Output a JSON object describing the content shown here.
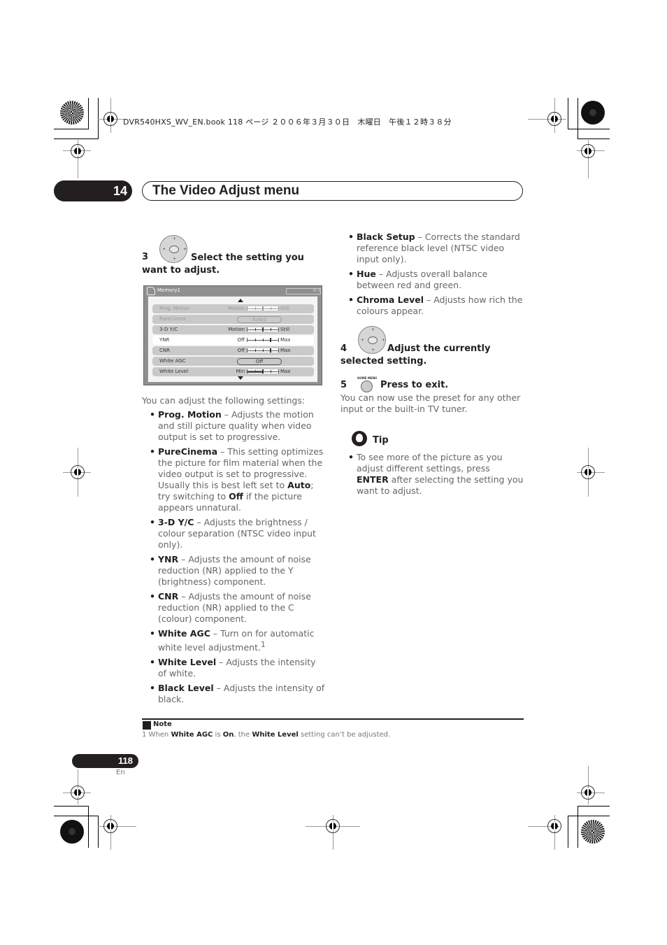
{
  "print_header": {
    "text": "DVR540HXS_WV_EN.book  118 ページ  ２００６年３月３０日　木曜日　午後１２時３８分"
  },
  "chapter": {
    "number": "14",
    "title": "The Video Adjust menu"
  },
  "steps": [
    {
      "number": "3",
      "icon": "dpad-enter-icon",
      "text": "Select the setting you want to adjust."
    },
    {
      "number": "4",
      "icon": "dpad-enter-icon",
      "text": "Adjust the currently selected setting."
    },
    {
      "number": "5",
      "icon": "home-menu-button-icon",
      "icon_label": "HOME MENU",
      "text": "Press to exit."
    }
  ],
  "osd": {
    "title": "Memory1",
    "corner_label": "Pr 1",
    "rows": [
      {
        "label": "Prog.  Motion",
        "low": "Motion",
        "high": "Still",
        "type": "slider",
        "level": 0.5,
        "state": "disabled"
      },
      {
        "label": "PureCinma",
        "type": "pill",
        "value": "Auto1",
        "state": "disabled"
      },
      {
        "label": "3-D  Y/C",
        "low": "Motion",
        "high": "Still",
        "type": "slider",
        "level": 0.5,
        "state": "normal"
      },
      {
        "label": "YNR",
        "low": "Off",
        "high": "Max",
        "type": "slider",
        "level": 0.75,
        "state": "selected"
      },
      {
        "label": "CNR",
        "low": "Off",
        "high": "Max",
        "type": "slider",
        "level": 0.75,
        "state": "normal"
      },
      {
        "label": "White  AGC",
        "type": "pill",
        "value": "Off",
        "state": "normal"
      },
      {
        "label": "White  Level",
        "low": "Min",
        "high": "Max",
        "type": "slider",
        "level": 0.5,
        "state": "normal"
      }
    ]
  },
  "intro": "You can adjust the following settings:",
  "settings_left": [
    {
      "term": "Prog. Motion",
      "desc": " – Adjusts the motion and still picture quality when video output is set to progressive."
    },
    {
      "term": "PureCinema",
      "desc": " –  This setting optimizes the picture for film material when the video output is set to progressive. Usually this is best left set to ",
      "b1": "Auto",
      "mid": "; try switching to ",
      "b2": "Off",
      "end": " if the picture appears unnatural."
    },
    {
      "term": "3-D Y/C",
      "desc": " – Adjusts the brightness / colour separation (NTSC video input only)."
    },
    {
      "term": "YNR",
      "desc": " – Adjusts the amount of noise reduction (NR) applied to the Y (brightness) component."
    },
    {
      "term": "CNR",
      "desc": " – Adjusts the amount of noise reduction (NR) applied to the C (colour) component."
    },
    {
      "term": "White AGC",
      "desc": " – Turn on for automatic white level adjustment.",
      "sup": "1"
    },
    {
      "term": "White Level",
      "desc": " – Adjusts the intensity of white."
    },
    {
      "term": "Black Level",
      "desc": " – Adjusts the intensity of black."
    }
  ],
  "settings_right": [
    {
      "term": "Black Setup",
      "desc": " – Corrects the standard reference black level (NTSC video input only)."
    },
    {
      "term": "Hue",
      "desc": " – Adjusts overall balance between red and green."
    },
    {
      "term": "Chroma Level",
      "desc": " – Adjusts how rich the colours appear."
    }
  ],
  "step5_body": "You can now use the preset for any other input or the built-in TV tuner.",
  "tip": {
    "label": "Tip",
    "pre": "To see more of the picture as you adjust different settings, press ",
    "bold": "ENTER",
    "post": " after selecting the setting you want to adjust."
  },
  "note": {
    "label": "Note",
    "n": "1",
    "t1": " When ",
    "b1": "White AGC",
    "t2": " is ",
    "b2": "On",
    "t3": ", the ",
    "b3": "White Level",
    "t4": " setting can’t be adjusted."
  },
  "footer": {
    "page_number": "118",
    "language": "En"
  }
}
